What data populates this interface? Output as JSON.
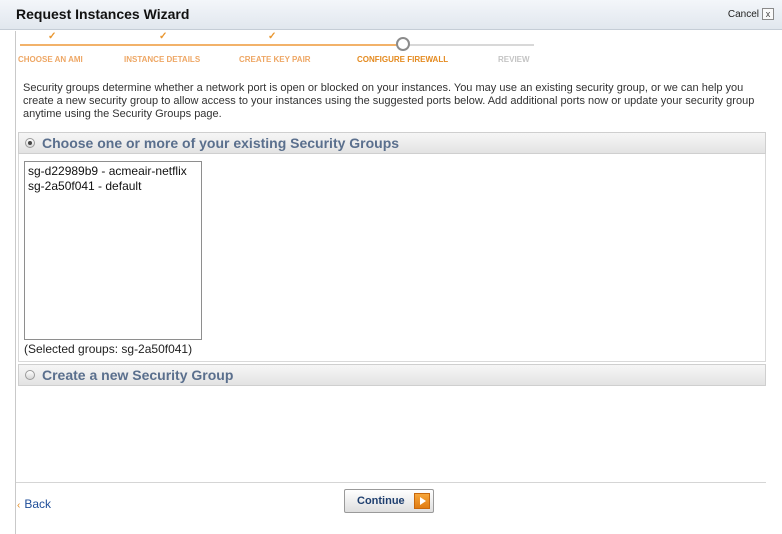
{
  "window": {
    "title": "Request Instances Wizard",
    "cancel_label": "Cancel",
    "close_glyph": "x"
  },
  "wizard": {
    "check_glyph": "✓",
    "steps": [
      {
        "label": "CHOOSE AN AMI",
        "state": "done"
      },
      {
        "label": "INSTANCE DETAILS",
        "state": "done"
      },
      {
        "label": "CREATE KEY PAIR",
        "state": "done"
      },
      {
        "label": "CONFIGURE FIREWALL",
        "state": "current"
      },
      {
        "label": "REVIEW",
        "state": "todo"
      }
    ]
  },
  "intro_text": "Security groups determine whether a network port is open or blocked on your instances. You may use an existing security group, or we can help you create a new security group to allow access to your instances using the suggested ports below. Add additional ports now or update your security group anytime using the Security Groups page.",
  "existing_section": {
    "title": "Choose one or more of your existing Security Groups",
    "selected": true,
    "groups": [
      "sg-d22989b9 - acmeair-netflix",
      "sg-2a50f041 - default"
    ],
    "selected_note": "(Selected groups: sg-2a50f041)"
  },
  "new_section": {
    "title": "Create a new Security Group",
    "selected": false
  },
  "footer": {
    "back_label": "Back",
    "back_glyph": "‹",
    "continue_label": "Continue"
  },
  "colors": {
    "accent_orange": "#e48a1f",
    "section_title": "#5a6f8d",
    "link_blue": "#1f4e99"
  }
}
